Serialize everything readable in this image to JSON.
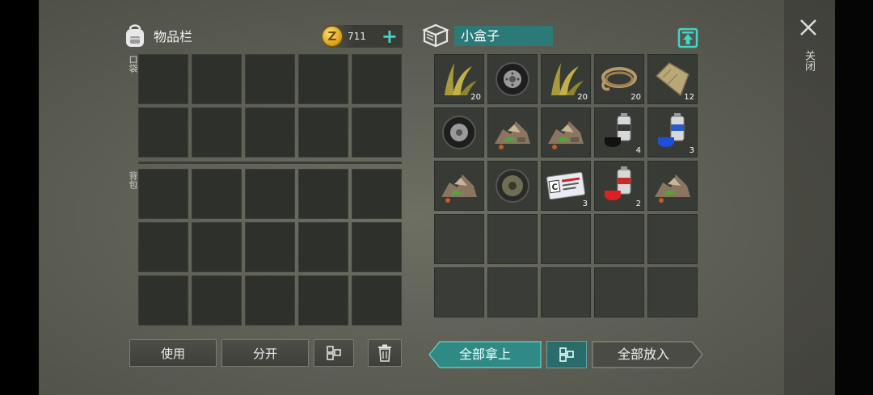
{
  "inventory": {
    "title": "物品栏",
    "coins": "711",
    "pocket_label": "口袋",
    "backpack_label": "背包"
  },
  "container": {
    "name": "小盒子"
  },
  "close_label": "关闭",
  "buttons": {
    "use": "使用",
    "split": "分开",
    "take_all": "全部拿上",
    "put_all": "全部放入"
  },
  "container_items": [
    {
      "item": "grass-fiber-icon",
      "qty": "20"
    },
    {
      "item": "tire-icon",
      "qty": ""
    },
    {
      "item": "grass-fiber-icon",
      "qty": "20"
    },
    {
      "item": "rope-icon",
      "qty": "20"
    },
    {
      "item": "cloth-icon",
      "qty": "12"
    },
    {
      "item": "tire-icon",
      "qty": ""
    },
    {
      "item": "scrap-pile-icon",
      "qty": ""
    },
    {
      "item": "scrap-pile-icon",
      "qty": ""
    },
    {
      "item": "spray-can-black-icon",
      "qty": "4"
    },
    {
      "item": "spray-can-blue-icon",
      "qty": "3"
    },
    {
      "item": "scrap-pile-icon",
      "qty": ""
    },
    {
      "item": "wheel-icon",
      "qty": ""
    },
    {
      "item": "id-card-icon",
      "qty": "3"
    },
    {
      "item": "spray-can-red-icon",
      "qty": "2"
    },
    {
      "item": "scrap-pile-icon",
      "qty": ""
    }
  ],
  "colors": {
    "accent_teal": "#3fd6c8",
    "box_name_bg": "#2c7a78"
  }
}
